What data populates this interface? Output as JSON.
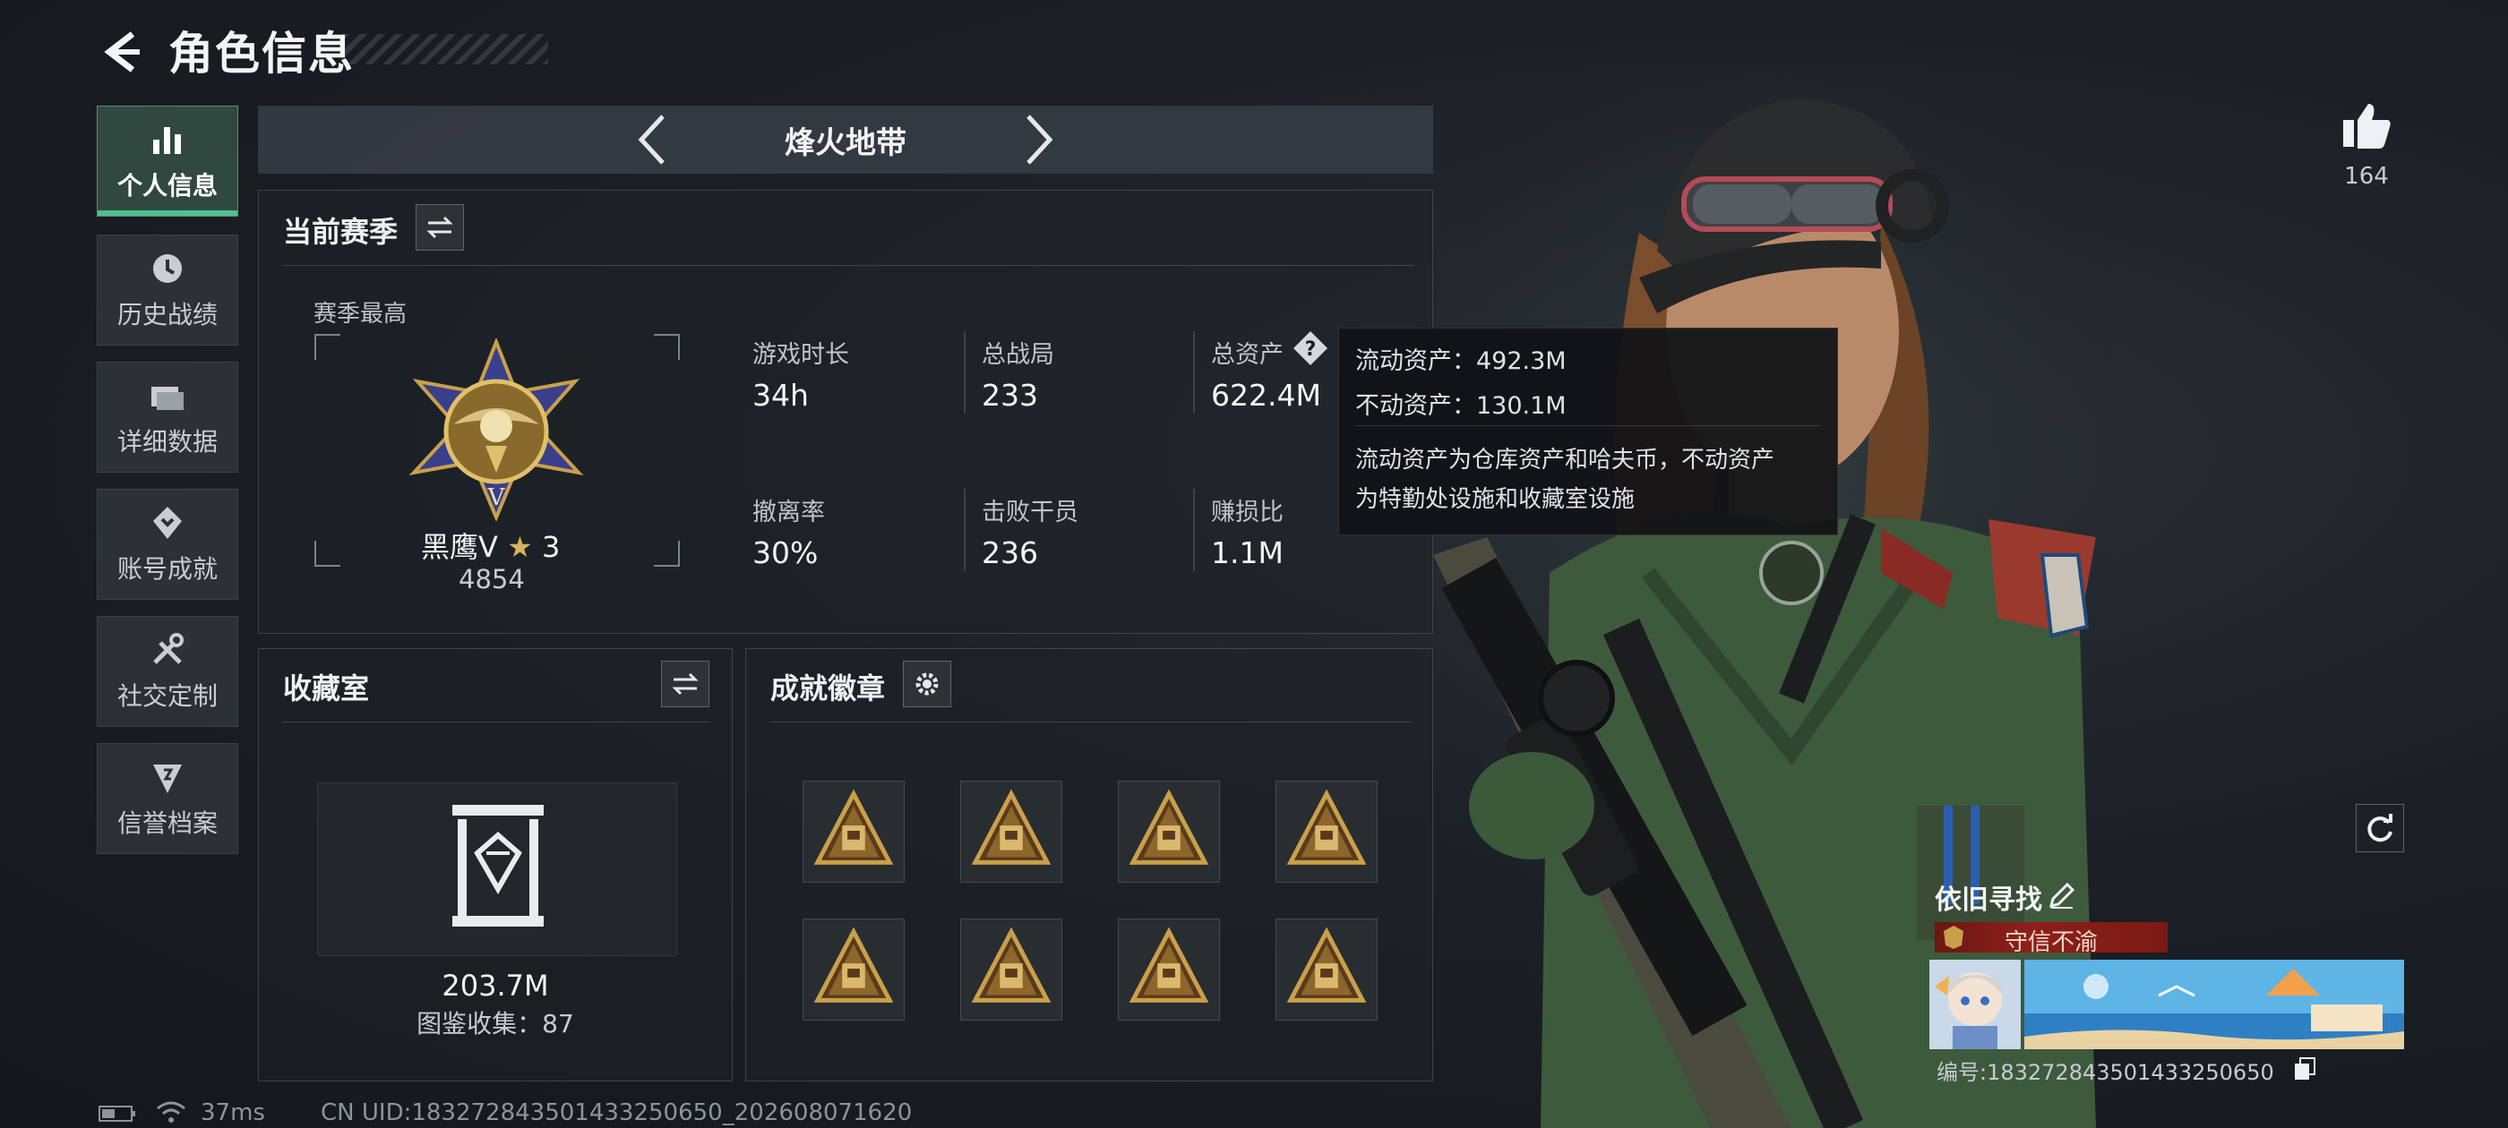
{
  "header": {
    "title": "角色信息"
  },
  "sidebar": {
    "items": [
      {
        "label": "个人信息",
        "icon": "bar-chart-icon",
        "active": true
      },
      {
        "label": "历史战绩",
        "icon": "history-clock-icon",
        "active": false
      },
      {
        "label": "详细数据",
        "icon": "folder-icon",
        "active": false
      },
      {
        "label": "账号成就",
        "icon": "achievement-icon",
        "active": false
      },
      {
        "label": "社交定制",
        "icon": "tools-icon",
        "active": false
      },
      {
        "label": "信誉档案",
        "icon": "reputation-icon",
        "active": false
      }
    ]
  },
  "mode": {
    "title": "烽火地带"
  },
  "season": {
    "title": "当前赛季",
    "best_label": "赛季最高",
    "rank_name": "黑鹰Ⅴ",
    "rank_stars": "3",
    "rank_points": "4854",
    "stats": [
      {
        "label": "游戏时长",
        "value": "34h"
      },
      {
        "label": "总战局",
        "value": "233"
      },
      {
        "label": "总资产",
        "value": "622.4M"
      },
      {
        "label": "撤离率",
        "value": "30%"
      },
      {
        "label": "击败干员",
        "value": "236"
      },
      {
        "label": "赚损比",
        "value": "1.1M"
      }
    ]
  },
  "tooltip": {
    "line1": "流动资产：492.3M",
    "line2": "不动资产：130.1M",
    "line3": "流动资产为仓库资产和哈夫币，不动资产",
    "line4": "为特勤处设施和收藏室设施"
  },
  "collection": {
    "title": "收藏室",
    "value": "203.7M",
    "catalog": "图鉴收集：87"
  },
  "badges": {
    "title": "成就徽章",
    "items": [
      "badge-1",
      "badge-2",
      "badge-3",
      "badge-4",
      "badge-5",
      "badge-6",
      "badge-7",
      "badge-8"
    ]
  },
  "likes": {
    "count": "164"
  },
  "profile": {
    "name": "依旧寻找",
    "title_banner": "守信不渝",
    "id_text": "编号:183272843501433250650"
  },
  "status": {
    "ping": "37ms",
    "uid": "CN UID:183272843501433250650_202608071620"
  },
  "colors": {
    "accent_green": "#4fc08b",
    "tooltip_bg": "#101215",
    "banner_red": "#8e1f1a",
    "gold": "#c9a04a"
  }
}
